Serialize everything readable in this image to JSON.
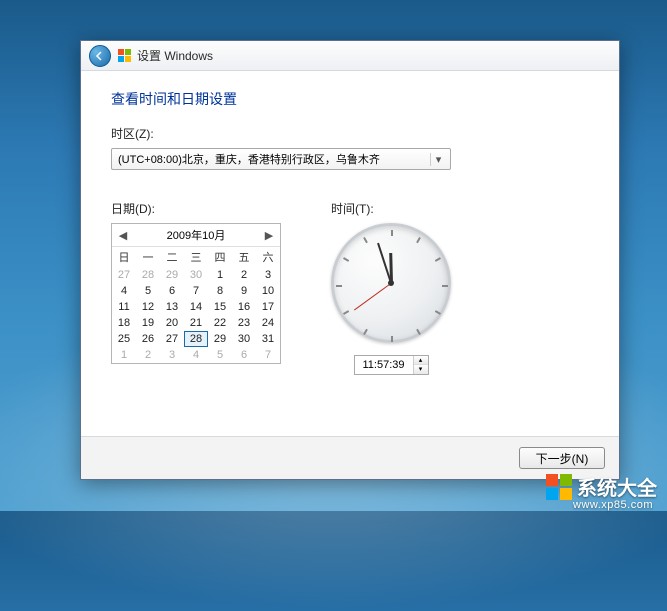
{
  "titlebar": {
    "text": "设置 Windows"
  },
  "page": {
    "title": "查看时间和日期设置"
  },
  "timezone": {
    "label": "时区(Z):",
    "selected": "(UTC+08:00)北京，重庆，香港特别行政区，乌鲁木齐"
  },
  "date": {
    "label": "日期(D):",
    "month_title": "2009年10月",
    "dow": [
      "日",
      "一",
      "二",
      "三",
      "四",
      "五",
      "六"
    ],
    "cells": [
      {
        "n": 27,
        "out": true
      },
      {
        "n": 28,
        "out": true
      },
      {
        "n": 29,
        "out": true
      },
      {
        "n": 30,
        "out": true
      },
      {
        "n": 1
      },
      {
        "n": 2
      },
      {
        "n": 3
      },
      {
        "n": 4
      },
      {
        "n": 5
      },
      {
        "n": 6
      },
      {
        "n": 7
      },
      {
        "n": 8
      },
      {
        "n": 9
      },
      {
        "n": 10
      },
      {
        "n": 11
      },
      {
        "n": 12
      },
      {
        "n": 13
      },
      {
        "n": 14
      },
      {
        "n": 15
      },
      {
        "n": 16
      },
      {
        "n": 17
      },
      {
        "n": 18
      },
      {
        "n": 19
      },
      {
        "n": 20
      },
      {
        "n": 21
      },
      {
        "n": 22
      },
      {
        "n": 23
      },
      {
        "n": 24
      },
      {
        "n": 25
      },
      {
        "n": 26
      },
      {
        "n": 27
      },
      {
        "n": 28,
        "selected": true
      },
      {
        "n": 29
      },
      {
        "n": 30
      },
      {
        "n": 31
      },
      {
        "n": 1,
        "out": true
      },
      {
        "n": 2,
        "out": true
      },
      {
        "n": 3,
        "out": true
      },
      {
        "n": 4,
        "out": true
      },
      {
        "n": 5,
        "out": true
      },
      {
        "n": 6,
        "out": true
      },
      {
        "n": 7,
        "out": true
      }
    ]
  },
  "time": {
    "label": "时间(T):",
    "value": "11:57:39",
    "hour_angle": 358.5,
    "minute_angle": 342,
    "second_angle": 234
  },
  "footer": {
    "next": "下一步(N)"
  },
  "watermark": {
    "text": "系统大全",
    "url": "www.xp85.com"
  }
}
